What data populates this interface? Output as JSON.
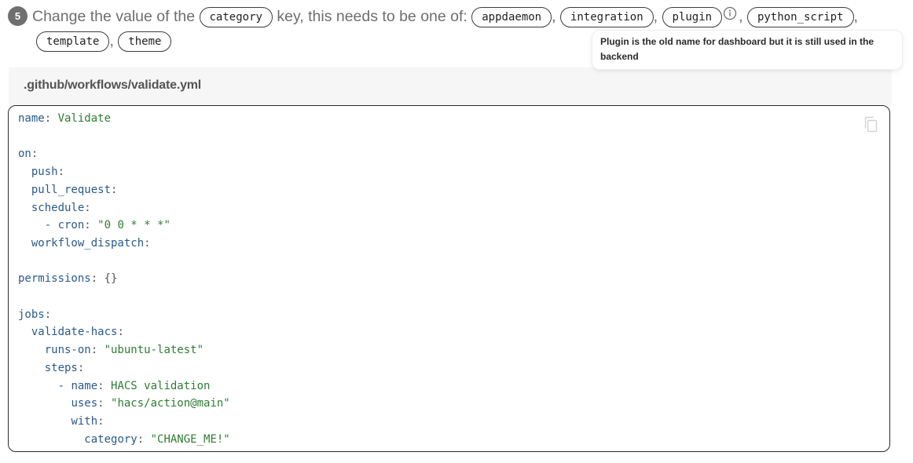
{
  "step": {
    "number": "5",
    "text_before": "Change the value of the",
    "key_pill": "category",
    "text_after": "key, this needs to be one of:",
    "options": [
      "appdaemon",
      "integration",
      "plugin",
      "python_script",
      "template",
      "theme"
    ],
    "separator": ",",
    "info_icon": "info-circle-icon",
    "tooltip": "Plugin is the old name for dashboard but it is still used in the backend"
  },
  "file": {
    "name": ".github/workflows/validate.yml"
  },
  "code": {
    "copy_icon": "copy-icon",
    "tokens": {
      "name": "name",
      "name_val": "Validate",
      "on": "on",
      "push": "push",
      "pull_request": "pull_request",
      "schedule": "schedule",
      "dash1": "- ",
      "cron": "cron",
      "cron_val": "\"0 0 * * *\"",
      "workflow_dispatch": "workflow_dispatch",
      "permissions": "permissions",
      "permissions_val": "{}",
      "jobs": "jobs",
      "validate_hacs": "validate-hacs",
      "runs_on": "runs-on",
      "runs_on_val": "\"ubuntu-latest\"",
      "steps": "steps",
      "dash2": "- ",
      "step_name": "name",
      "step_name_val": "HACS validation",
      "uses": "uses",
      "uses_val": "\"hacs/action@main\"",
      "with": "with",
      "category": "category",
      "category_val": "\"CHANGE_ME!\""
    }
  },
  "colors": {
    "key": "#2b5a8a",
    "string": "#2e7d32",
    "badge": "#6f6f6f"
  }
}
